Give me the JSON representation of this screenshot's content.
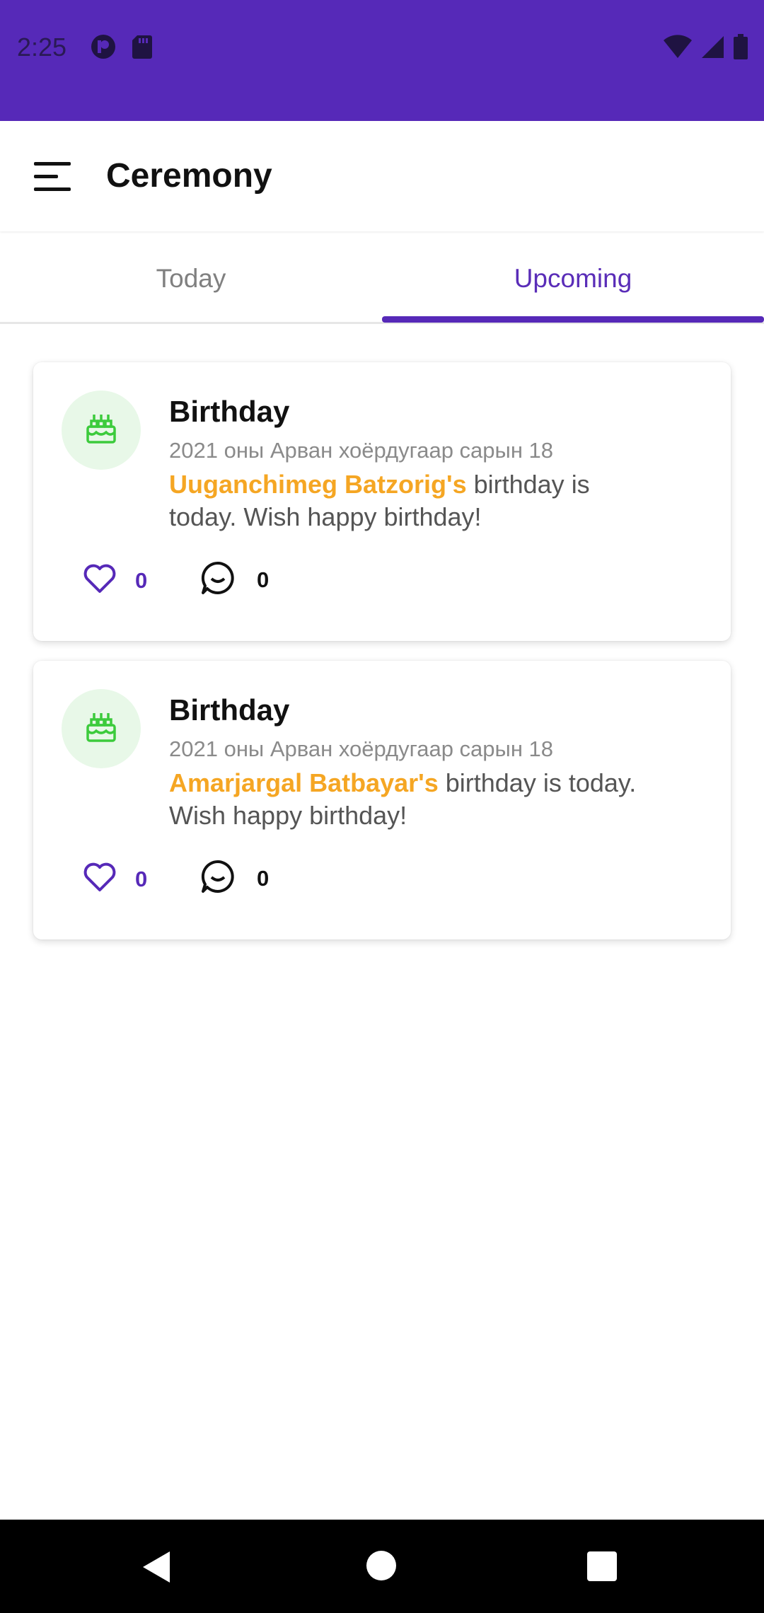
{
  "status_bar": {
    "time": "2:25",
    "icons": [
      "app-notification-icon",
      "sd-card-icon",
      "wifi-icon",
      "cellular-signal-icon",
      "battery-icon"
    ],
    "background": "#5629B8"
  },
  "app_bar": {
    "title": "Ceremony",
    "menu_icon": "hamburger-menu-icon"
  },
  "tabs": [
    {
      "label": "Today",
      "selected": false
    },
    {
      "label": "Upcoming",
      "selected": true
    }
  ],
  "cards": [
    {
      "icon": "birthday-cake-icon",
      "title": "Birthday",
      "date": "2021 оны Арван хоёрдугаар сарын 18",
      "name": "Uuganchimeg Batzorig's",
      "message": " birthday is today. Wish happy birthday!",
      "likes": "0",
      "comments": "0"
    },
    {
      "icon": "birthday-cake-icon",
      "title": "Birthday",
      "date": "2021 оны Арван хоёрдугаар сарын 18",
      "name": "Amarjargal Batbayar's",
      "message": " birthday is today. Wish happy birthday!",
      "likes": "0",
      "comments": "0"
    }
  ],
  "colors": {
    "accent": "#5629B8",
    "highlight_name": "#F5A623",
    "cake_icon": "#3CCB3C",
    "avatar_bg": "#E8F8E8"
  },
  "nav_bar": {
    "icons": [
      "back-icon",
      "home-icon",
      "recents-icon"
    ]
  }
}
